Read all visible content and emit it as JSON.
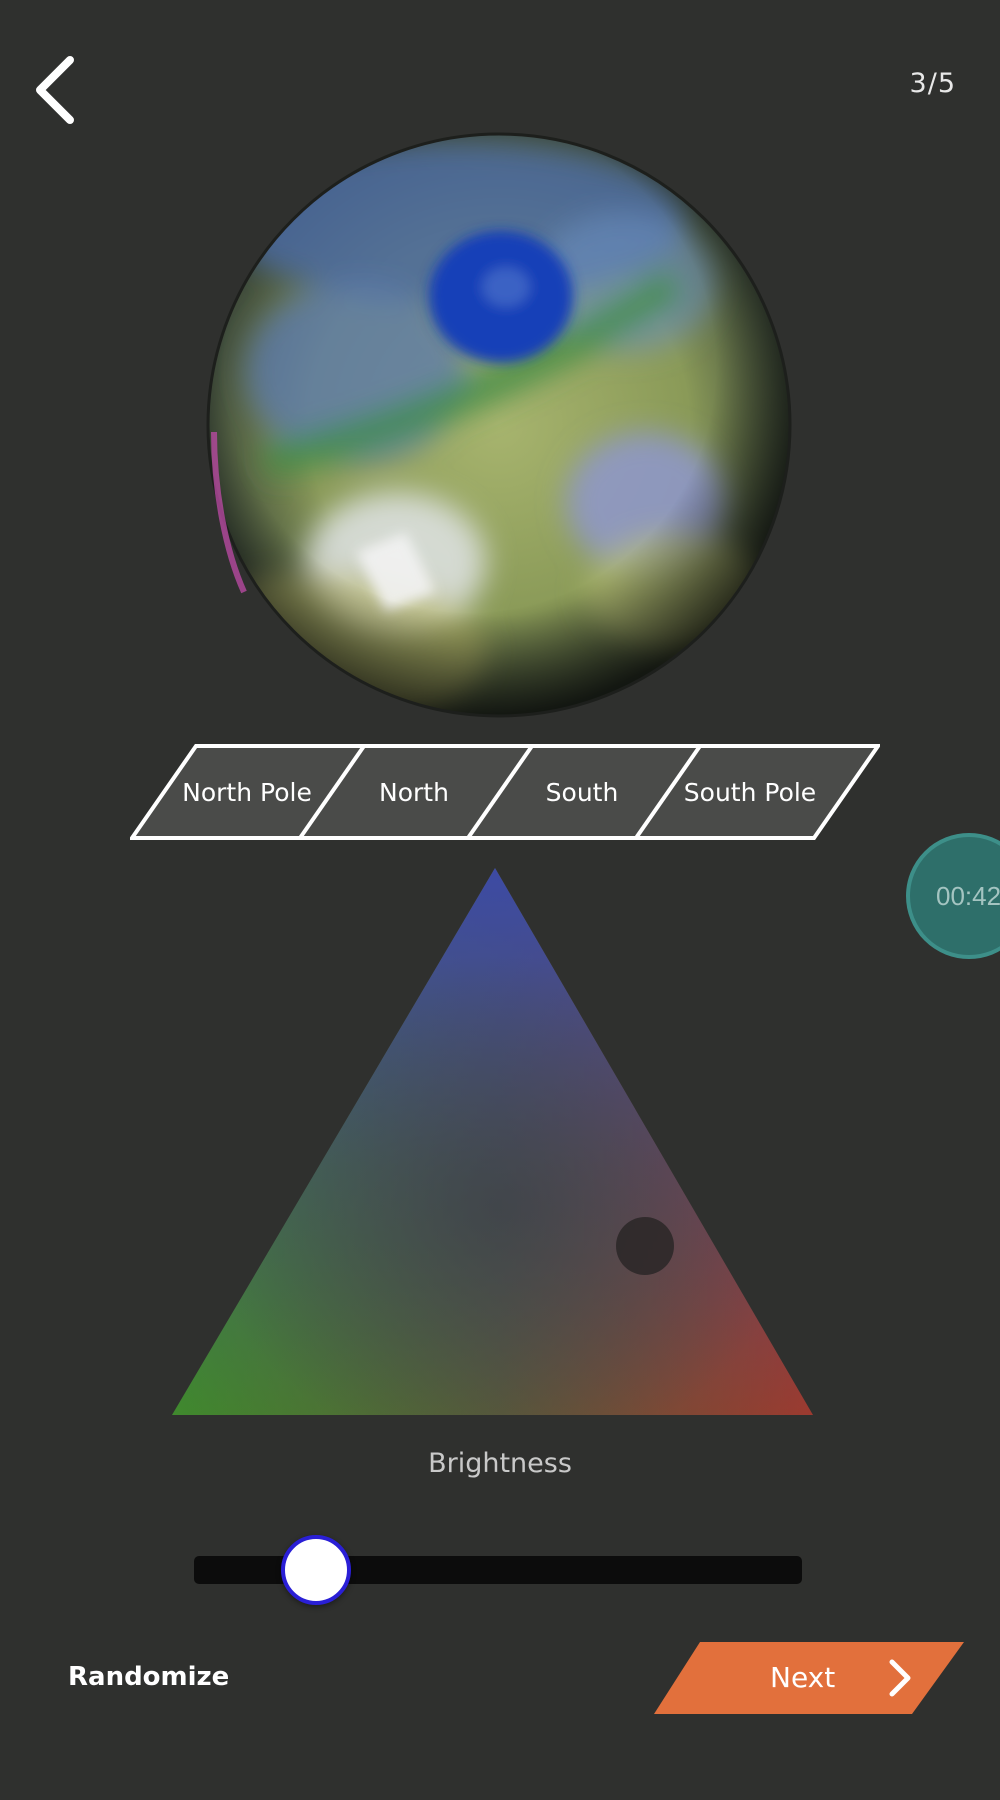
{
  "header": {
    "back_icon": "chevron-left-icon",
    "page_counter": "3/5"
  },
  "planet": {
    "description_icon": "planet-globe"
  },
  "region_tabs": [
    {
      "label": "North Pole"
    },
    {
      "label": "North"
    },
    {
      "label": "South"
    },
    {
      "label": "South Pole"
    }
  ],
  "timer": {
    "value": "00:42"
  },
  "color_picker": {
    "corner_colors": {
      "top": "#3a4a9a",
      "bottom_left": "#3f8a2c",
      "bottom_right": "#9a3a30"
    }
  },
  "brightness": {
    "label": "Brightness",
    "value": 0.2
  },
  "footer": {
    "randomize_label": "Randomize",
    "next_label": "Next",
    "next_color": "#e2703c"
  },
  "colors": {
    "background": "#2f302e",
    "accent": "#e2703c",
    "timer": "#2e6f6a"
  }
}
